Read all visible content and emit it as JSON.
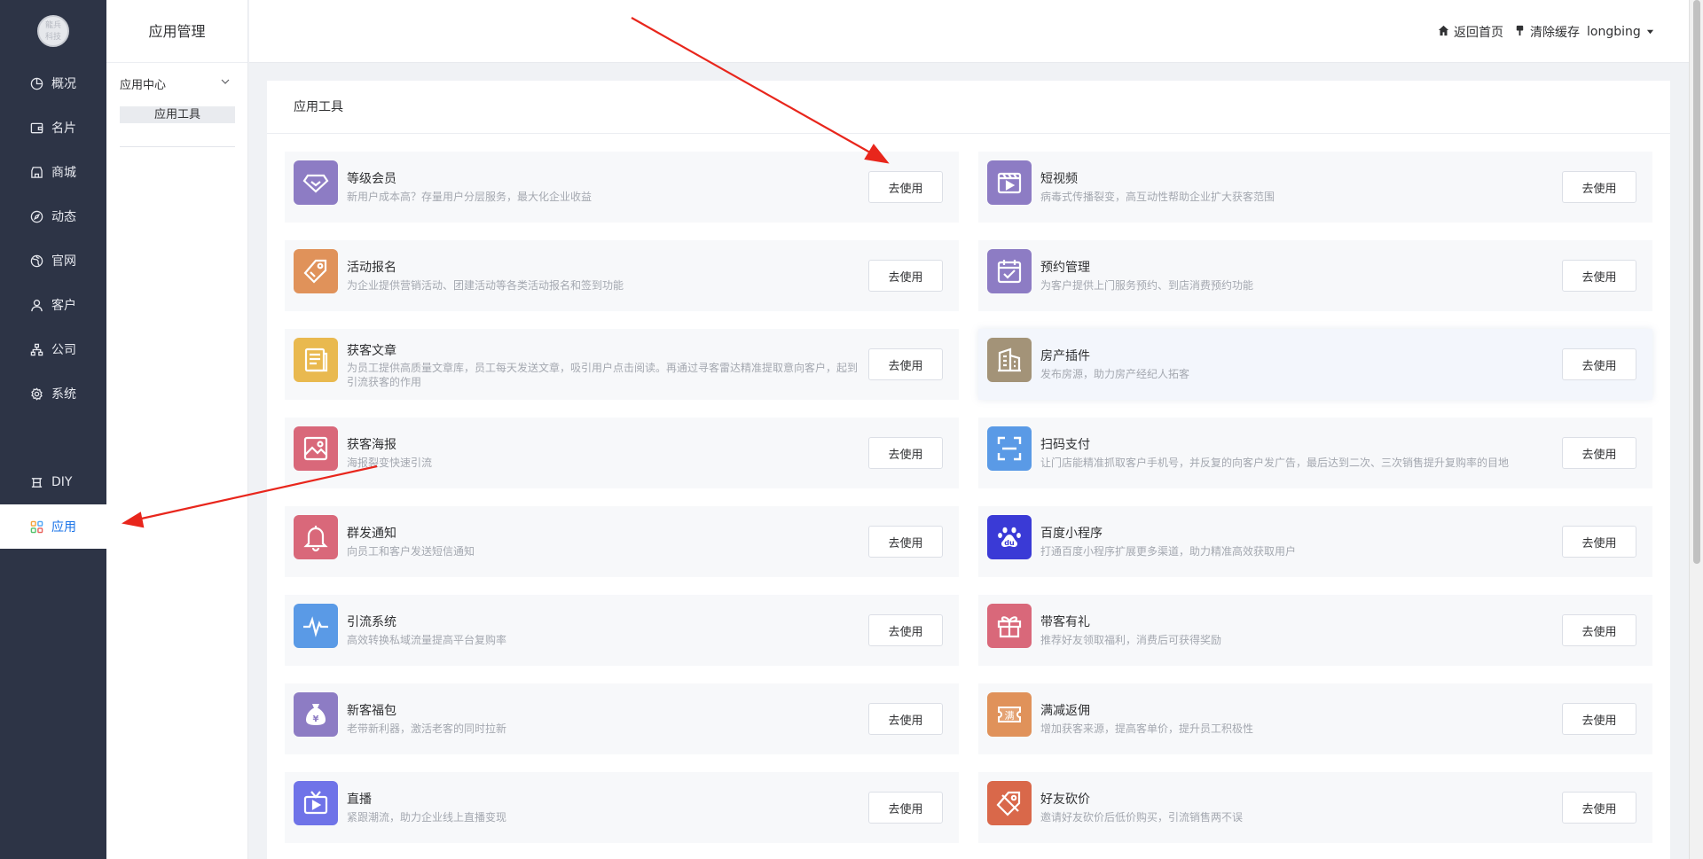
{
  "brand": {
    "logo_text": "龍兵\n科技"
  },
  "rail": {
    "items": [
      {
        "label": "概况",
        "icon": "pie-chart-icon"
      },
      {
        "label": "名片",
        "icon": "wallet-icon"
      },
      {
        "label": "商城",
        "icon": "shop-icon"
      },
      {
        "label": "动态",
        "icon": "compass-icon"
      },
      {
        "label": "官网",
        "icon": "globe-icon"
      },
      {
        "label": "客户",
        "icon": "user-icon"
      },
      {
        "label": "公司",
        "icon": "org-chart-icon"
      },
      {
        "label": "系统",
        "icon": "gear-icon"
      },
      {
        "label": "DIY",
        "icon": "diy-icon"
      },
      {
        "label": "应用",
        "icon": "apps-grid-icon",
        "active": true
      }
    ]
  },
  "subside": {
    "title": "应用管理",
    "group_label": "应用中心",
    "active_item": "应用工具"
  },
  "topbar": {
    "home_label": "返回首页",
    "clear_cache_label": "清除缓存",
    "user_label": "longbing"
  },
  "main": {
    "title": "应用工具",
    "button_label": "去使用",
    "tools": [
      {
        "name": "等级会员",
        "desc": "新用户成本高？存量用户分层服务，最大化企业收益",
        "color": "#8d7cc4",
        "icon": "diamond-icon"
      },
      {
        "name": "短视频",
        "desc": "病毒式传播裂变，高互动性帮助企业扩大获客范围",
        "color": "#8d7cc4",
        "icon": "video-icon"
      },
      {
        "name": "活动报名",
        "desc": "为企业提供营销活动、团建活动等各类活动报名和签到功能",
        "color": "#e0925a",
        "icon": "tag-icon"
      },
      {
        "name": "预约管理",
        "desc": "为客户提供上门服务预约、到店消费预约功能",
        "color": "#8d7cc4",
        "icon": "calendar-check-icon"
      },
      {
        "name": "获客文章",
        "desc": "为员工提供高质量文章库，员工每天发送文章，吸引用户点击阅读。再通过寻客雷达精准提取意向客户，起到引流获客的作用",
        "color": "#e9b94f",
        "icon": "article-icon"
      },
      {
        "name": "房产插件",
        "desc": "发布房源，助力房产经纪人拓客",
        "color": "#a39378",
        "icon": "building-icon"
      },
      {
        "name": "获客海报",
        "desc": "海报裂变快速引流",
        "color": "#d9687a",
        "icon": "poster-icon"
      },
      {
        "name": "扫码支付",
        "desc": "让门店能精准抓取客户手机号，并反复的向客户发广告，最后达到二次、三次销售提升复购率的目地",
        "color": "#5a9ae6",
        "icon": "scan-icon"
      },
      {
        "name": "群发通知",
        "desc": "向员工和客户发送短信通知",
        "color": "#d9687a",
        "icon": "bell-icon"
      },
      {
        "name": "百度小程序",
        "desc": "打通百度小程序扩展更多渠道，助力精准高效获取用户",
        "color": "#3a3ad6",
        "icon": "baidu-paw-icon"
      },
      {
        "name": "引流系统",
        "desc": "高效转换私域流量提高平台复购率",
        "color": "#5a9ae6",
        "icon": "pulse-icon"
      },
      {
        "name": "带客有礼",
        "desc": "推荐好友领取福利，消费后可获得奖励",
        "color": "#d9687a",
        "icon": "gift-icon"
      },
      {
        "name": "新客福包",
        "desc": "老带新利器，激活老客的同时拉新",
        "color": "#8d7cc4",
        "icon": "money-bag-icon"
      },
      {
        "name": "满减返佣",
        "desc": "增加获客来源，提高客单价，提升员工积极性",
        "color": "#e0925a",
        "icon": "coupon-icon",
        "badge": "满"
      },
      {
        "name": "直播",
        "desc": "紧跟潮流，助力企业线上直播变现",
        "color": "#6f73e8",
        "icon": "live-tv-icon"
      },
      {
        "name": "好友砍价",
        "desc": "邀请好友砍价后低价购买，引流销售两不误",
        "color": "#d9684a",
        "icon": "bargain-icon"
      }
    ]
  }
}
